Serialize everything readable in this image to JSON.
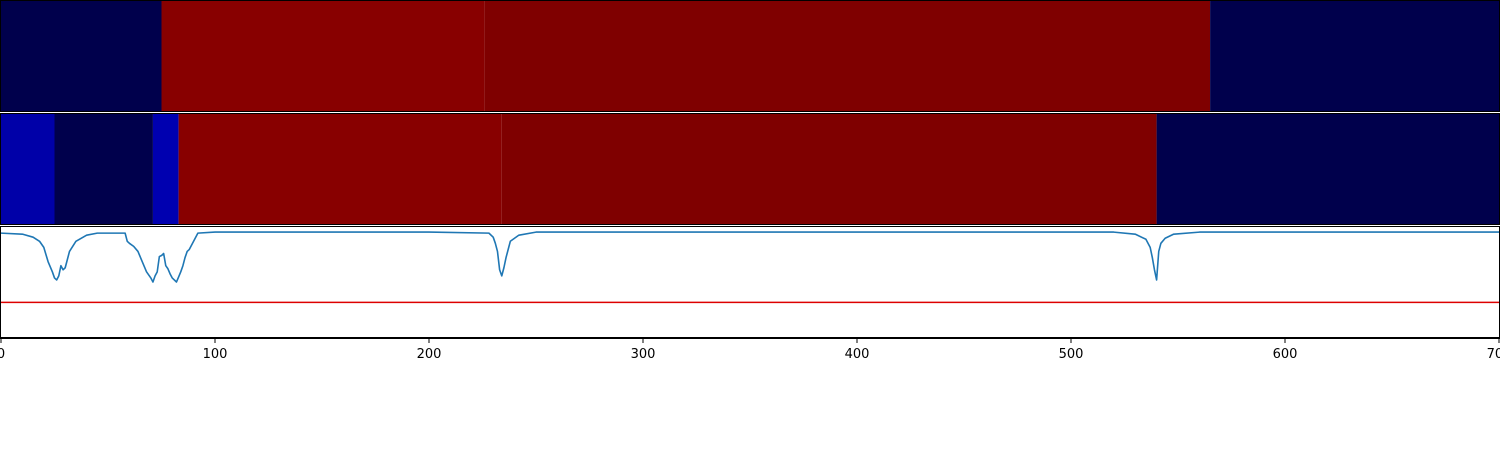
{
  "chart_data": [
    {
      "type": "heatmap",
      "panel": "top",
      "xlim": [
        0,
        700
      ],
      "segments": [
        {
          "x0": 0,
          "x1": 75,
          "color": "#00004c"
        },
        {
          "x0": 75,
          "x1": 226,
          "color": "#880000"
        },
        {
          "x0": 226,
          "x1": 565,
          "color": "#7f0000"
        },
        {
          "x0": 565,
          "x1": 700,
          "color": "#00004c"
        }
      ]
    },
    {
      "type": "heatmap",
      "panel": "middle",
      "xlim": [
        0,
        700
      ],
      "segments": [
        {
          "x0": 0,
          "x1": 25,
          "color": "#0000a8"
        },
        {
          "x0": 25,
          "x1": 71,
          "color": "#00004c"
        },
        {
          "x0": 71,
          "x1": 83,
          "color": "#0000b0"
        },
        {
          "x0": 83,
          "x1": 234,
          "color": "#880000"
        },
        {
          "x0": 234,
          "x1": 540,
          "color": "#7f0000"
        },
        {
          "x0": 540,
          "x1": 700,
          "color": "#00004c"
        }
      ]
    },
    {
      "type": "line",
      "panel": "bottom",
      "xlim": [
        0,
        700
      ],
      "ylim": [
        -1.05,
        0.05
      ],
      "xticks": [
        0,
        100,
        200,
        300,
        400,
        500,
        600,
        700
      ],
      "xtick_labels": [
        "0",
        "100",
        "200",
        "300",
        "400",
        "500",
        "600",
        "700"
      ],
      "threshold": {
        "y": -0.7,
        "color": "#dd0000"
      },
      "series": [
        {
          "color": "#1f77b4",
          "x": [
            0,
            10,
            15,
            18,
            20,
            22,
            24,
            25,
            26,
            27,
            28,
            29,
            30,
            32,
            35,
            40,
            45,
            58,
            59,
            60,
            62,
            64,
            66,
            68,
            70,
            71,
            72,
            73,
            74,
            75,
            76,
            77,
            78,
            79,
            80,
            82,
            83,
            84,
            85,
            86,
            87,
            88,
            90,
            92,
            100,
            200,
            228,
            230,
            231,
            232,
            233,
            234,
            235,
            236,
            238,
            242,
            250,
            520,
            530,
            535,
            537,
            538,
            539,
            540,
            541,
            542,
            544,
            548,
            560,
            700
          ],
          "y": [
            -0.02,
            -0.03,
            -0.06,
            -0.1,
            -0.16,
            -0.3,
            -0.4,
            -0.46,
            -0.48,
            -0.44,
            -0.34,
            -0.38,
            -0.36,
            -0.2,
            -0.1,
            -0.04,
            -0.02,
            -0.02,
            -0.1,
            -0.12,
            -0.15,
            -0.2,
            -0.3,
            -0.4,
            -0.46,
            -0.5,
            -0.44,
            -0.4,
            -0.25,
            -0.24,
            -0.22,
            -0.34,
            -0.37,
            -0.42,
            -0.46,
            -0.5,
            -0.45,
            -0.4,
            -0.34,
            -0.26,
            -0.2,
            -0.18,
            -0.1,
            -0.02,
            -0.01,
            -0.01,
            -0.02,
            -0.06,
            -0.12,
            -0.2,
            -0.38,
            -0.44,
            -0.36,
            -0.26,
            -0.1,
            -0.04,
            -0.01,
            -0.01,
            -0.03,
            -0.08,
            -0.16,
            -0.26,
            -0.38,
            -0.48,
            -0.2,
            -0.12,
            -0.07,
            -0.03,
            -0.01,
            -0.01
          ]
        }
      ]
    }
  ]
}
